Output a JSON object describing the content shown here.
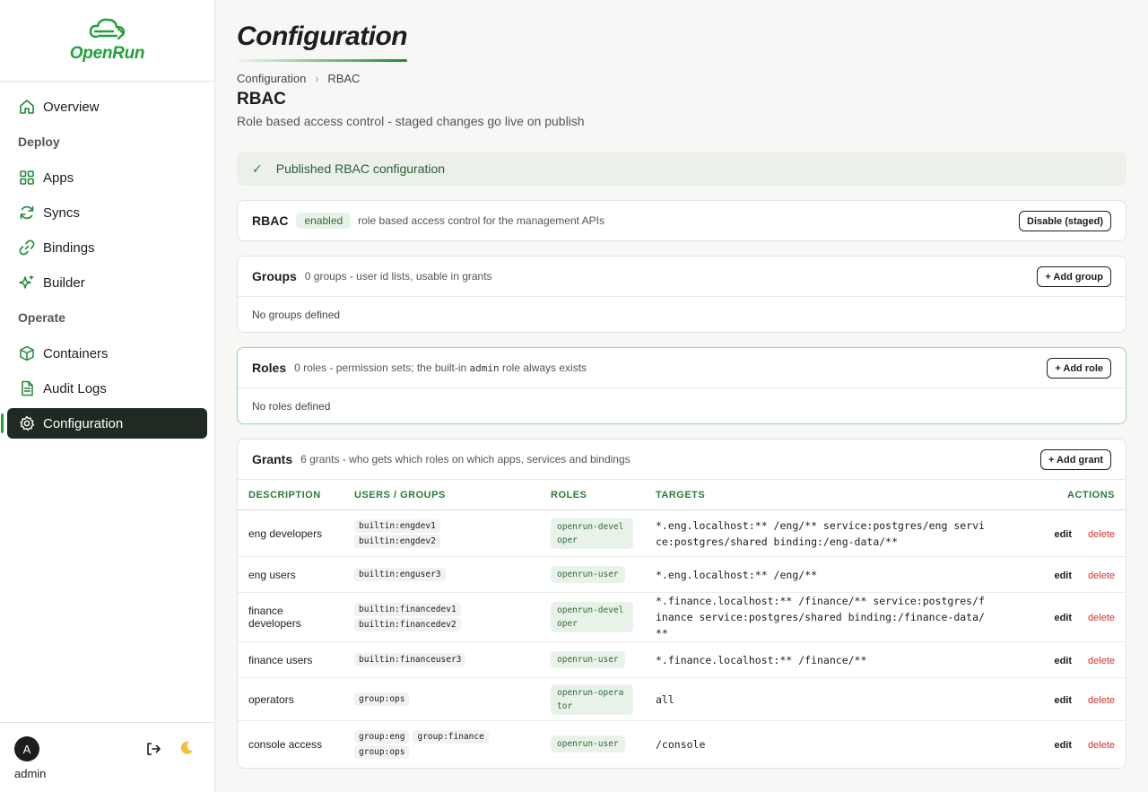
{
  "brand": {
    "name": "OpenRun"
  },
  "sidebar": {
    "items": [
      {
        "type": "item",
        "label": "Overview",
        "icon": "home-icon"
      },
      {
        "type": "section",
        "label": "Deploy"
      },
      {
        "type": "item",
        "label": "Apps",
        "icon": "grid-icon"
      },
      {
        "type": "item",
        "label": "Syncs",
        "icon": "sync-icon"
      },
      {
        "type": "item",
        "label": "Bindings",
        "icon": "link-icon"
      },
      {
        "type": "item",
        "label": "Builder",
        "icon": "sparkle-icon"
      },
      {
        "type": "section",
        "label": "Operate"
      },
      {
        "type": "item",
        "label": "Containers",
        "icon": "cube-icon"
      },
      {
        "type": "item",
        "label": "Audit Logs",
        "icon": "document-icon"
      },
      {
        "type": "item",
        "label": "Configuration",
        "icon": "gear-icon",
        "active": true
      }
    ],
    "user": {
      "initial": "A",
      "name": "admin"
    }
  },
  "page": {
    "heading": "Configuration",
    "breadcrumb": [
      "Configuration",
      "RBAC"
    ],
    "title": "RBAC",
    "description": "Role based access control - staged changes go live on publish"
  },
  "alert": {
    "message": "Published RBAC configuration"
  },
  "rbac_card": {
    "title": "RBAC",
    "badge": "enabled",
    "description": "role based access control for the management APIs",
    "button": "Disable (staged)"
  },
  "groups_card": {
    "title": "Groups",
    "description": "0 groups - user id lists, usable in grants",
    "button": "+ Add group",
    "empty": "No groups defined"
  },
  "roles_card": {
    "title": "Roles",
    "description_pre": "0 roles - permission sets; the built-in ",
    "description_code": "admin",
    "description_post": " role always exists",
    "button": "+ Add role",
    "empty": "No roles defined"
  },
  "grants_card": {
    "title": "Grants",
    "description": "6 grants - who gets which roles on which apps, services and bindings",
    "button": "+ Add grant",
    "columns": [
      "DESCRIPTION",
      "USERS / GROUPS",
      "ROLES",
      "TARGETS",
      "ACTIONS"
    ],
    "edit_label": "edit",
    "delete_label": "delete",
    "rows": [
      {
        "description": "eng developers",
        "users": [
          "builtin:engdev1",
          "builtin:engdev2"
        ],
        "role": "openrun-developer",
        "targets": "*.eng.localhost:** /eng/** service:postgres/eng service:postgres/shared binding:/eng-data/**"
      },
      {
        "description": "eng users",
        "users": [
          "builtin:enguser3"
        ],
        "role": "openrun-user",
        "targets": "*.eng.localhost:** /eng/**"
      },
      {
        "description": "finance developers",
        "users": [
          "builtin:financedev1",
          "builtin:financedev2"
        ],
        "role": "openrun-developer",
        "targets": "*.finance.localhost:** /finance/** service:postgres/finance service:postgres/shared binding:/finance-data/**"
      },
      {
        "description": "finance users",
        "users": [
          "builtin:financeuser3"
        ],
        "role": "openrun-user",
        "targets": "*.finance.localhost:** /finance/**"
      },
      {
        "description": "operators",
        "users": [
          "group:ops"
        ],
        "role": "openrun-operator",
        "targets": "all"
      },
      {
        "description": "console access",
        "users": [
          "group:eng",
          "group:finance",
          "group:ops"
        ],
        "role": "openrun-user",
        "targets": "/console"
      }
    ]
  },
  "colors": {
    "accent": "#22a03a",
    "active_bg": "#1f2a22",
    "danger": "#d0342c"
  }
}
